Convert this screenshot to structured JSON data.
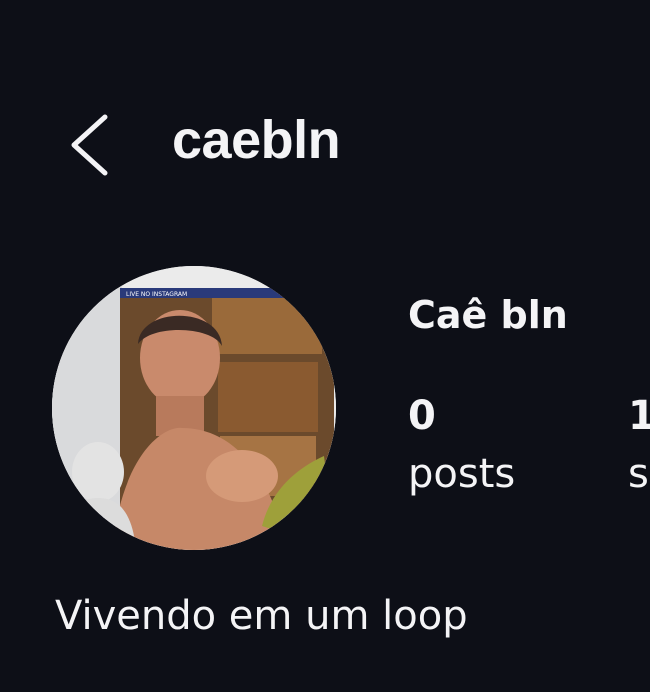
{
  "header": {
    "username": "caebln",
    "back_icon": "chevron-left-icon"
  },
  "profile": {
    "display_name": "Caê bln",
    "avatar_banner": "LIVE NO INSTAGRAM",
    "stats": [
      {
        "value": "0",
        "label": "posts"
      },
      {
        "value": "1",
        "label": "s"
      }
    ],
    "bio": "Vivendo em um loop"
  },
  "colors": {
    "background": "#0d0f17",
    "text": "#f4f4f6"
  }
}
